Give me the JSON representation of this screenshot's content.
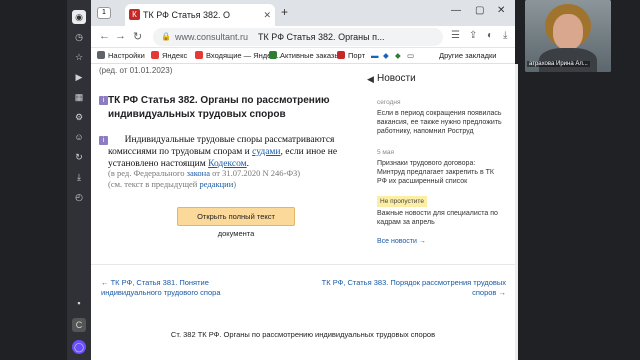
{
  "browser": {
    "tab_title": "ТК РФ Статья 382. О",
    "tab_group": "1",
    "url_host": "www.consultant.ru",
    "page_title": "ТК РФ Статья 382. Органы п..."
  },
  "bookmarks": [
    {
      "label": "Настройки",
      "color": "#5f6368"
    },
    {
      "label": "Яндекс",
      "color": "#e53935"
    },
    {
      "label": "Входящие — Яндек...",
      "color": "#e53935"
    },
    {
      "label": "Активные заказы",
      "color": "#2e7d32"
    },
    {
      "label": "Порт",
      "color": "#c62828"
    }
  ],
  "bookmarks_more": "Другие закладки",
  "article": {
    "cutoff": "(ред. от 01.01.2023)",
    "heading": "ТК РФ Статья 382. Органы по рассмотрению индивидуальных трудовых споров",
    "body_1": "Индивидуальные трудовые споры рассматриваются комиссиями по трудовым спорам и ",
    "body_link_1": "судами",
    "body_2": ", если иное не установлено настоящим ",
    "body_link_2": "Кодексом",
    "body_3": ".",
    "note_1": "(в ред. Федерального ",
    "note_link_1": "закона",
    "note_2": " от 31.07.2020 N 246-ФЗ)",
    "note_3": "(см. текст в предыдущей ",
    "note_link_2": "редакции",
    "note_4": ")",
    "open_button": "Открыть полный текст документа"
  },
  "news": {
    "title": "Новости",
    "items": [
      {
        "date": "сегодня",
        "text": "Если в период сокращения появилась вакансия, ее также нужно предложить работнику, напомнил Роструд"
      },
      {
        "date": "5 мая",
        "text": "Признаки трудового договора: Минтруд предлагает закрепить в ТК РФ их расширенный список"
      },
      {
        "badge": "Не пропустите",
        "text": "Важные новости для специалиста по кадрам за апрель"
      }
    ],
    "all_news": "Все новости →"
  },
  "nav": {
    "prev": "ТК РФ, Статья 381. Понятие индивидуального трудового спора",
    "next": "ТК РФ, Статья 383. Порядок рассмотрения трудовых споров"
  },
  "footer_title": "Ст. 382 ТК РФ. Органы по рассмотрению индивидуальных трудовых споров",
  "video": {
    "name": "атрахова Ирина Ал..."
  }
}
